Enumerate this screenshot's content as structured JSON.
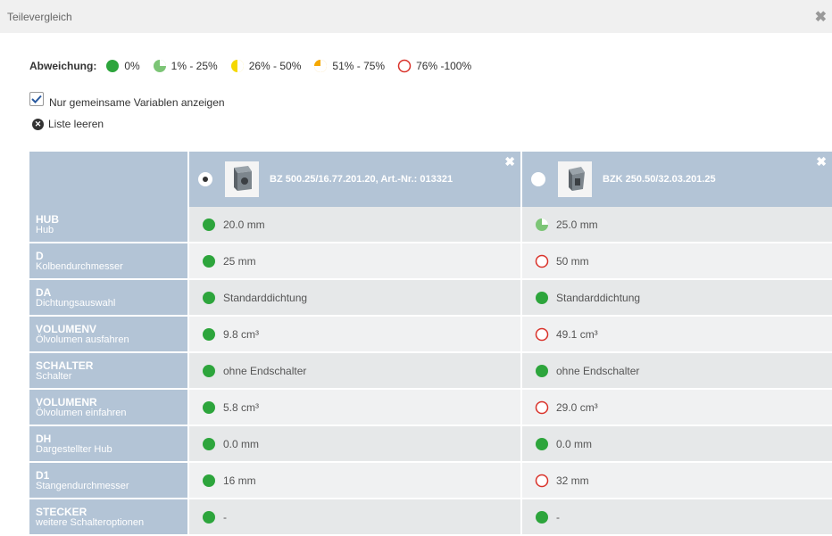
{
  "window": {
    "title": "Teilevergleich",
    "close_icon": "close-icon"
  },
  "legend": {
    "label": "Abweichung:",
    "items": [
      {
        "text": "0%",
        "icon": "status-full-green",
        "color": "#2da53c"
      },
      {
        "text": "1% - 25%",
        "icon": "status-quarter-green",
        "color": "#7cc576"
      },
      {
        "text": "26% - 50%",
        "icon": "status-half-yellow",
        "color": "#f5d800"
      },
      {
        "text": "51% - 75%",
        "icon": "status-threequarter-orange",
        "color": "#f5a800"
      },
      {
        "text": "76% -100%",
        "icon": "status-empty-red",
        "color": "#d9322a"
      }
    ]
  },
  "options": {
    "common_only_label": "Nur gemeinsame Variablen anzeigen",
    "common_only_checked": true,
    "clear_label": "Liste leeren"
  },
  "products": [
    {
      "name": "BZ 500.25/16.77.201.20, Art.-Nr.: 013321",
      "selected": true
    },
    {
      "name": "BZK 250.50/32.03.201.25",
      "selected": false
    }
  ],
  "rows": [
    {
      "key": "HUB",
      "desc": "Hub",
      "v1": "20.0 mm",
      "s1": "full",
      "v2": "25.0 mm",
      "s2": "quarter"
    },
    {
      "key": "D",
      "desc": "Kolbendurchmesser",
      "v1": "25 mm",
      "s1": "full",
      "v2": "50 mm",
      "s2": "empty"
    },
    {
      "key": "DA",
      "desc": "Dichtungsauswahl",
      "v1": "Standarddichtung",
      "s1": "full",
      "v2": "Standarddichtung",
      "s2": "full"
    },
    {
      "key": "VOLUMENV",
      "desc": "Ölvolumen ausfahren",
      "v1": "9.8 cm³",
      "s1": "full",
      "v2": "49.1 cm³",
      "s2": "empty"
    },
    {
      "key": "SCHALTER",
      "desc": "Schalter",
      "v1": "ohne Endschalter",
      "s1": "full",
      "v2": "ohne Endschalter",
      "s2": "full"
    },
    {
      "key": "VOLUMENR",
      "desc": "Ölvolumen einfahren",
      "v1": "5.8 cm³",
      "s1": "full",
      "v2": "29.0 cm³",
      "s2": "empty"
    },
    {
      "key": "DH",
      "desc": "Dargestellter Hub",
      "v1": "0.0 mm",
      "s1": "full",
      "v2": "0.0 mm",
      "s2": "full"
    },
    {
      "key": "D1",
      "desc": "Stangendurchmesser",
      "v1": "16 mm",
      "s1": "full",
      "v2": "32 mm",
      "s2": "empty"
    },
    {
      "key": "STECKER",
      "desc": "weitere Schalteroptionen",
      "v1": "-",
      "s1": "full",
      "v2": "-",
      "s2": "full"
    }
  ]
}
